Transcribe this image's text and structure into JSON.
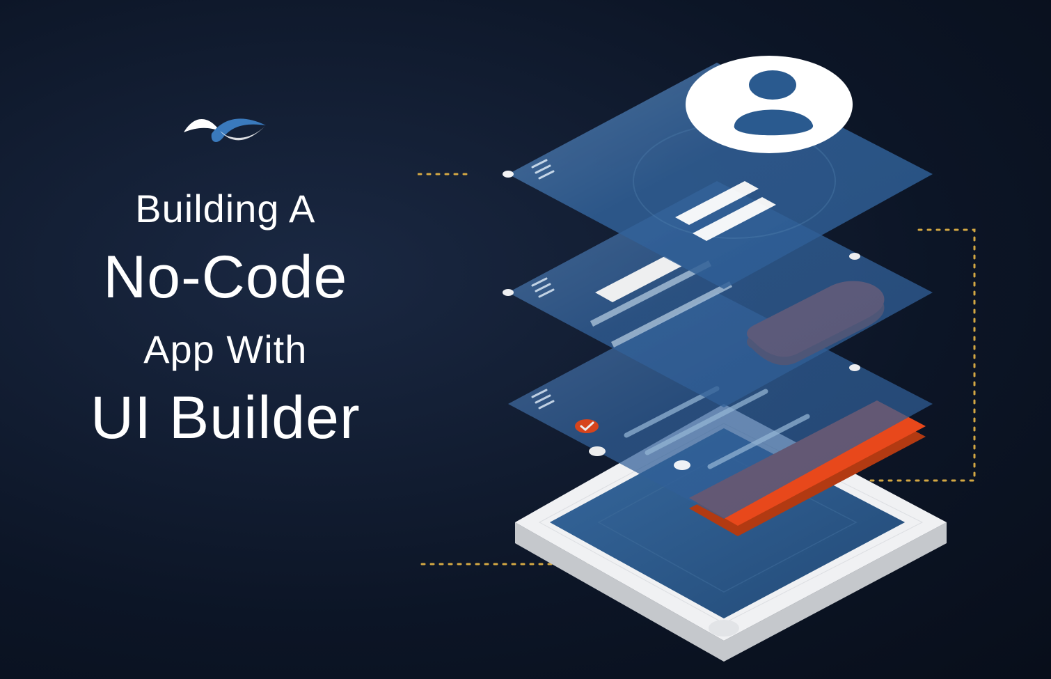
{
  "headline": {
    "line1": "Building A",
    "line2": "No-Code",
    "line3": "App With",
    "line4": "UI Builder"
  },
  "logo_name": "backendless-logo",
  "illustration_name": "isometric-phone-layers"
}
